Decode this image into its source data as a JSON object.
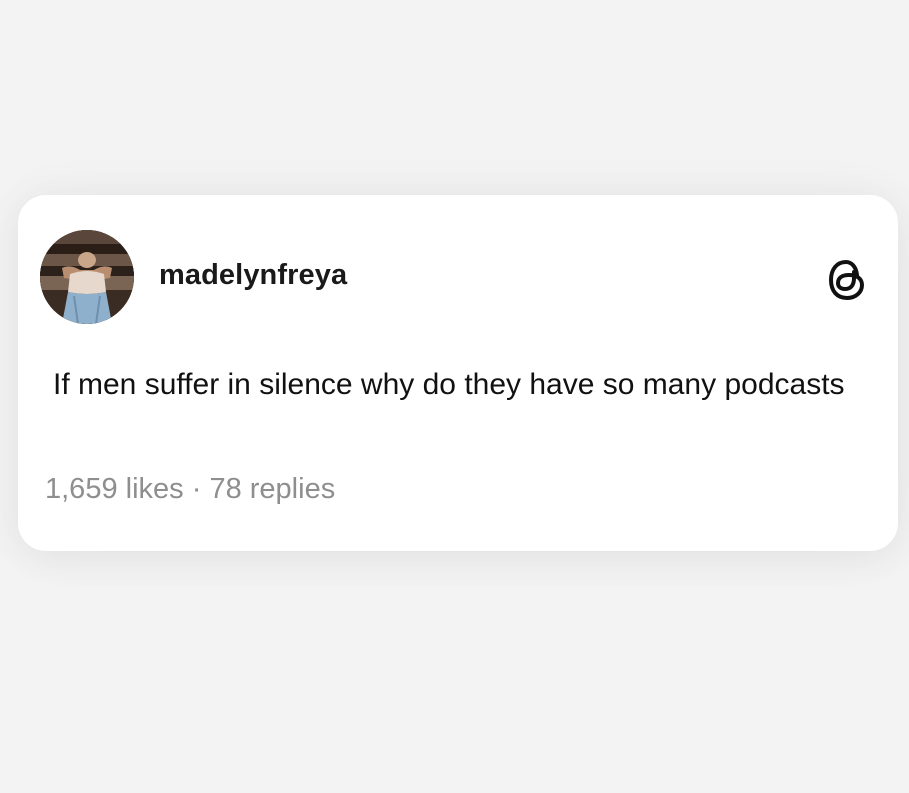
{
  "post": {
    "username": "madelynfreya",
    "avatar": "profile-photo",
    "platform_icon": "threads-logo-icon",
    "text": "If men suffer in silence why do they have so many podcasts",
    "likes": "1,659 likes",
    "separator": "·",
    "replies": "78 replies"
  },
  "colors": {
    "background": "#f3f3f4",
    "card": "#ffffff",
    "text": "#111111",
    "muted": "#8e8e8e"
  }
}
